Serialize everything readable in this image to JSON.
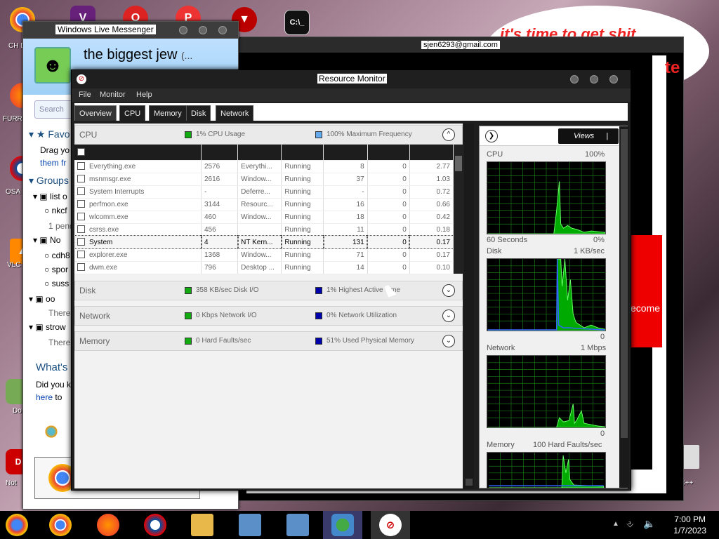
{
  "desktop": {
    "icons": [
      {
        "name": "chrome-desktop-icon",
        "label": "CH D"
      },
      {
        "name": "firefox-desktop-icon",
        "label": "FURR"
      },
      {
        "name": "osa-desktop-icon",
        "label": "OSA LAD"
      },
      {
        "name": "vlc-desktop-icon",
        "label": "VLC P"
      },
      {
        "name": "doc-desktop-icon",
        "label": "Do"
      },
      {
        "name": "notepad-desktop-icon",
        "label": "Not"
      }
    ],
    "red_title": "it's time to get shit",
    "red_letters": "te",
    "welcome": "ecome",
    "right_label": "n C++"
  },
  "bg_window": {
    "title": "sjen6293@gmail.com"
  },
  "messenger": {
    "title": "Windows Live Messenger",
    "display_name": "the biggest jew",
    "display_name_suffix": "(...",
    "search_placeholder": "Search",
    "favorites": "Favo",
    "drag": "Drag yo",
    "them": "them fr",
    "groups": "Groups",
    "list_of": "list o",
    "nkcf": "nkcf",
    "pending": "1 pend",
    "no": "No",
    "cdh": "cdh8",
    "spor": "spor",
    "suss": "suss",
    "oo": "oo",
    "there1": "There",
    "strow": "strow",
    "there2": "There",
    "whats": "What's",
    "did_you": "Did you k",
    "here": "here",
    "to": "to"
  },
  "resmon": {
    "title": "Resource Monitor",
    "menus": [
      "File",
      "Monitor",
      "Help"
    ],
    "tabs": [
      "Overview",
      "CPU",
      "Memory",
      "Disk",
      "Network"
    ],
    "cpu": {
      "name": "CPU",
      "usage": "1% CPU Usage",
      "freq": "100% Maximum Frequency"
    },
    "disk": {
      "name": "Disk",
      "io": "358 KB/sec Disk I/O",
      "active": "1% Highest Active Time"
    },
    "network": {
      "name": "Network",
      "io": "0 Kbps Network I/O",
      "util": "0% Network Utilization"
    },
    "memory": {
      "name": "Memory",
      "faults": "0 Hard Faults/sec",
      "used": "51% Used Physical Memory"
    },
    "processes": [
      {
        "image": "Everything.exe",
        "pid": "2576",
        "desc": "Everythi...",
        "status": "Running",
        "threads": "8",
        "cpu": "0",
        "avg": "2.77"
      },
      {
        "image": "msnmsgr.exe",
        "pid": "2616",
        "desc": "Window...",
        "status": "Running",
        "threads": "37",
        "cpu": "0",
        "avg": "1.03"
      },
      {
        "image": "System Interrupts",
        "pid": "-",
        "desc": "Deferre...",
        "status": "Running",
        "threads": "-",
        "cpu": "0",
        "avg": "0.72"
      },
      {
        "image": "perfmon.exe",
        "pid": "3144",
        "desc": "Resourc...",
        "status": "Running",
        "threads": "16",
        "cpu": "0",
        "avg": "0.66"
      },
      {
        "image": "wlcomm.exe",
        "pid": "460",
        "desc": "Window...",
        "status": "Running",
        "threads": "18",
        "cpu": "0",
        "avg": "0.42"
      },
      {
        "image": "csrss.exe",
        "pid": "456",
        "desc": "",
        "status": "Running",
        "threads": "11",
        "cpu": "0",
        "avg": "0.18"
      },
      {
        "image": "System",
        "pid": "4",
        "desc": "NT Kern...",
        "status": "Running",
        "threads": "131",
        "cpu": "0",
        "avg": "0.17"
      },
      {
        "image": "explorer.exe",
        "pid": "1368",
        "desc": "Window...",
        "status": "Running",
        "threads": "71",
        "cpu": "0",
        "avg": "0.17"
      },
      {
        "image": "dwm.exe",
        "pid": "796",
        "desc": "Desktop ...",
        "status": "Running",
        "threads": "14",
        "cpu": "0",
        "avg": "0.10"
      }
    ],
    "views_label": "Views",
    "graphs": {
      "cpu_label": "CPU",
      "cpu_max": "100%",
      "cpu_time": "60 Seconds",
      "cpu_min": "0%",
      "disk_label": "Disk",
      "disk_max": "1 KB/sec",
      "disk_min": "0",
      "net_label": "Network",
      "net_max": "1 Mbps",
      "net_min": "0",
      "mem_label": "Memory",
      "mem_max": "100 Hard Faults/sec"
    }
  },
  "taskbar": {
    "time": "7:00 PM",
    "date": "1/7/2023"
  }
}
